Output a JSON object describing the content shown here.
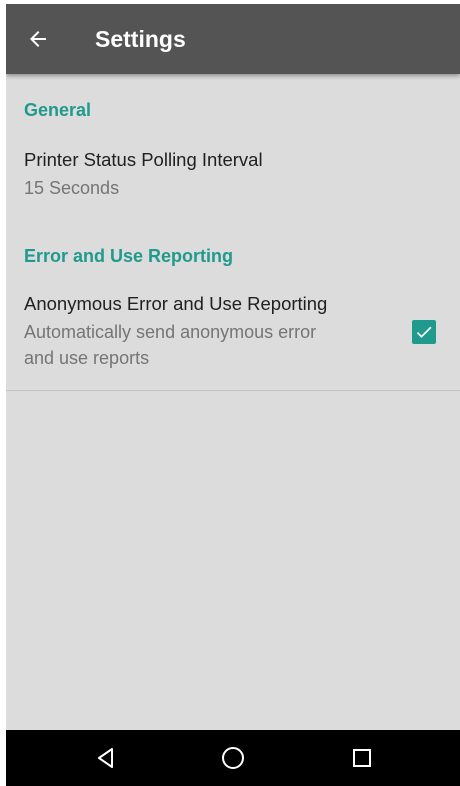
{
  "app_bar": {
    "title": "Settings",
    "back_icon": "arrow-back-icon",
    "background": "#545454"
  },
  "sections": [
    {
      "header": "General",
      "items": [
        {
          "title": "Printer Status Polling Interval",
          "summary": "15 Seconds"
        }
      ]
    },
    {
      "header": "Error and Use Reporting",
      "items": [
        {
          "title": "Anonymous Error and Use Reporting",
          "summary_line1": "Automatically send anonymous error",
          "summary_line2": "and use reports",
          "checked": true
        }
      ]
    }
  ],
  "colors": {
    "accent": "#1f9a8c",
    "background": "#dcdcdc",
    "nav_bar": "#000000"
  },
  "nav_bar": {
    "buttons": [
      "back-triangle-icon",
      "home-circle-icon",
      "recents-square-icon"
    ]
  }
}
